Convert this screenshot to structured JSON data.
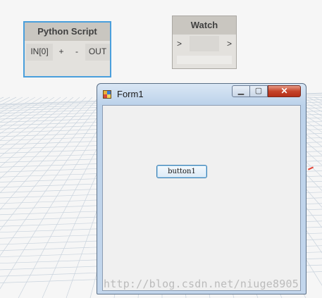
{
  "nodes": {
    "python_script": {
      "title": "Python Script",
      "input_port": "IN[0]",
      "add_label": "+",
      "remove_label": "-",
      "output_port": "OUT"
    },
    "watch": {
      "title": "Watch",
      "input_port": ">",
      "output_port": ">"
    }
  },
  "form": {
    "title": "Form1",
    "minimize_label": "▁",
    "maximize_label": "▢",
    "close_label": "✕",
    "button1_label": "button1"
  },
  "watermark": "http://blog.csdn.net/niuge8905",
  "colors": {
    "selection": "#4a9fdc",
    "close_button": "#c5442a"
  }
}
